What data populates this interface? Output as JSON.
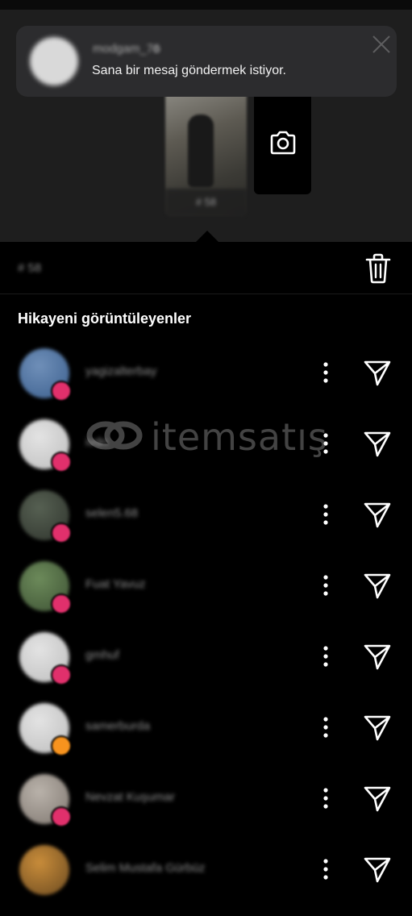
{
  "notification": {
    "username": "modgam_7",
    "username_suffix": "ö",
    "message": "Sana bir mesaj göndermek istiyor."
  },
  "story": {
    "thumbnail_count": "# 58",
    "views_count": "# 58"
  },
  "section": {
    "title": "Hikayeni görüntüleyenler"
  },
  "viewers": [
    {
      "name": "yagizalterbay",
      "badge": "heart",
      "avatar_colors": [
        "#6f8fb8",
        "#3b5f8e"
      ]
    },
    {
      "name": "ivdn",
      "badge": "heart",
      "avatar_colors": [
        "#e3e3e3",
        "#bdbdbd"
      ]
    },
    {
      "name": "selen5.68",
      "badge": "heart",
      "avatar_colors": [
        "#566052",
        "#2f342d"
      ]
    },
    {
      "name": "Fuat Yavuz",
      "badge": "heart",
      "avatar_colors": [
        "#6c8a5a",
        "#3d5234"
      ]
    },
    {
      "name": "gmhuf",
      "badge": "heart",
      "avatar_colors": [
        "#e3e3e3",
        "#bdbdbd"
      ]
    },
    {
      "name": "samerburda",
      "badge": "fire",
      "avatar_colors": [
        "#e3e3e3",
        "#bdbdbd"
      ]
    },
    {
      "name": "Nevzat Kuşumar",
      "badge": "heart",
      "avatar_colors": [
        "#b9b2aa",
        "#7f7770"
      ]
    },
    {
      "name": "Selim Mustafa Gürbüz",
      "badge": "none",
      "avatar_colors": [
        "#c88c3a",
        "#6b4a20"
      ]
    }
  ],
  "watermark": {
    "brand": "itemsatış"
  },
  "colors": {
    "badge_heart": "#e1306c",
    "badge_fire": "#f7931e",
    "background": "#000000",
    "toast_bg": "#2c2c2e"
  }
}
